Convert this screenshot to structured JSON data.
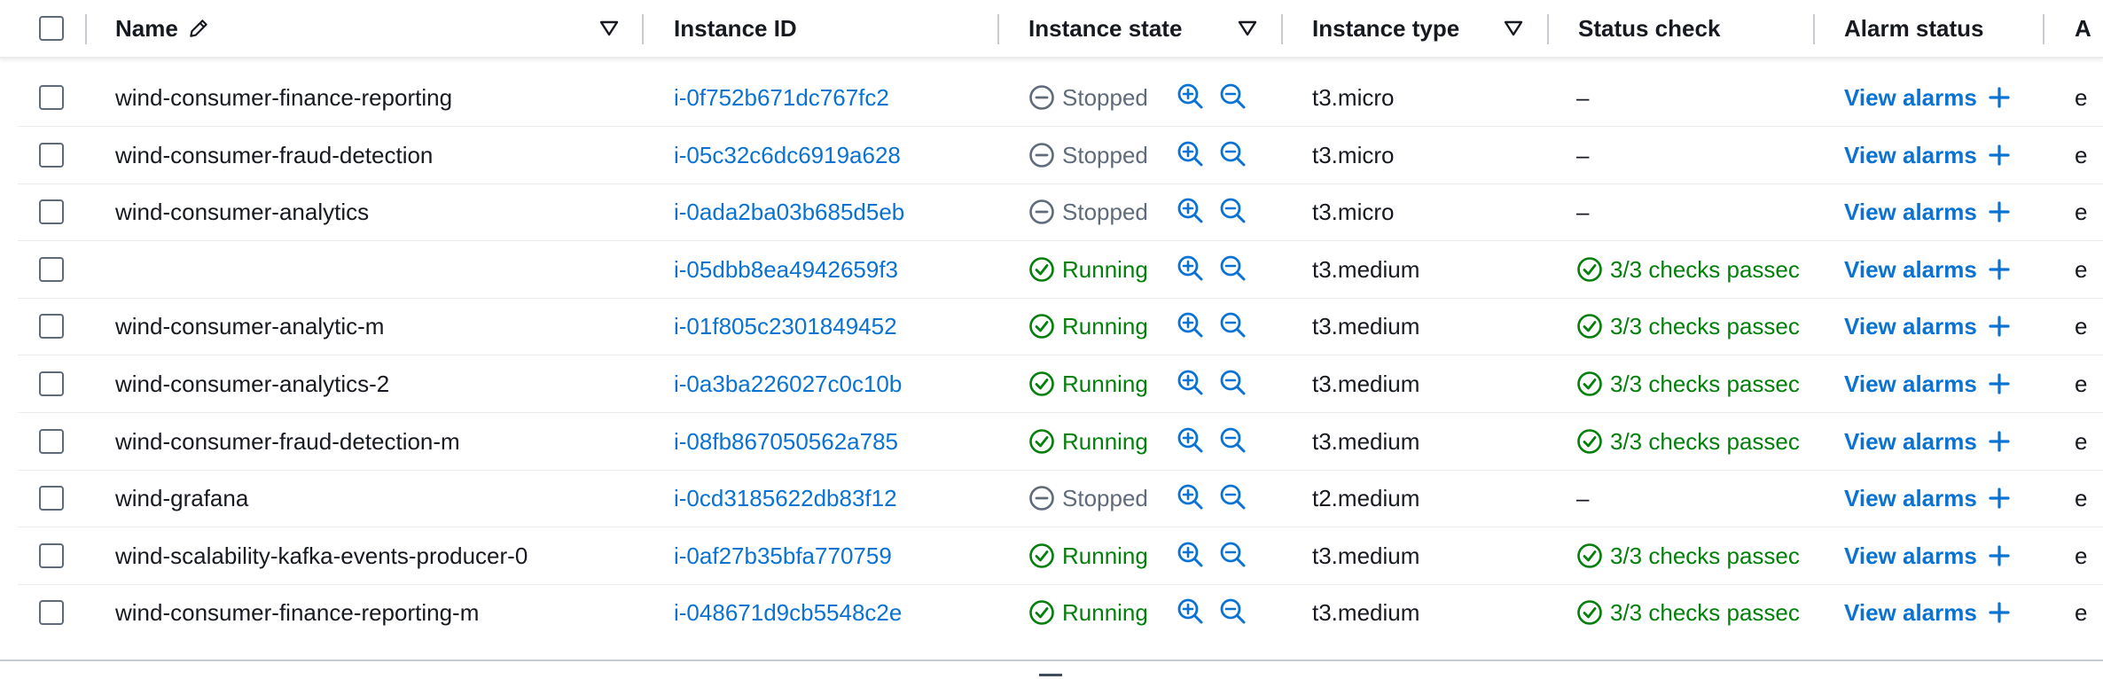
{
  "header": {
    "name": "Name",
    "instance_id": "Instance ID",
    "instance_state": "Instance state",
    "instance_type": "Instance type",
    "status_check": "Status check",
    "alarm_status": "Alarm status",
    "next_col": "A"
  },
  "rows": [
    {
      "name": "wind-consumer-finance-reporting",
      "id": "i-0f752b671dc767fc2",
      "state": "Stopped",
      "type": "t3.micro",
      "status": "–",
      "alarm": "View alarms",
      "next": "e"
    },
    {
      "name": "wind-consumer-fraud-detection",
      "id": "i-05c32c6dc6919a628",
      "state": "Stopped",
      "type": "t3.micro",
      "status": "–",
      "alarm": "View alarms",
      "next": "e"
    },
    {
      "name": "wind-consumer-analytics",
      "id": "i-0ada2ba03b685d5eb",
      "state": "Stopped",
      "type": "t3.micro",
      "status": "–",
      "alarm": "View alarms",
      "next": "e"
    },
    {
      "name": "",
      "id": "i-05dbb8ea4942659f3",
      "state": "Running",
      "type": "t3.medium",
      "status": "3/3 checks passec",
      "alarm": "View alarms",
      "next": "e"
    },
    {
      "name": "wind-consumer-analytic-m",
      "id": "i-01f805c2301849452",
      "state": "Running",
      "type": "t3.medium",
      "status": "3/3 checks passec",
      "alarm": "View alarms",
      "next": "e"
    },
    {
      "name": "wind-consumer-analytics-2",
      "id": "i-0a3ba226027c0c10b",
      "state": "Running",
      "type": "t3.medium",
      "status": "3/3 checks passec",
      "alarm": "View alarms",
      "next": "e"
    },
    {
      "name": "wind-consumer-fraud-detection-m",
      "id": "i-08fb867050562a785",
      "state": "Running",
      "type": "t3.medium",
      "status": "3/3 checks passec",
      "alarm": "View alarms",
      "next": "e"
    },
    {
      "name": "wind-grafana",
      "id": "i-0cd3185622db83f12",
      "state": "Stopped",
      "type": "t2.medium",
      "status": "–",
      "alarm": "View alarms",
      "next": "e"
    },
    {
      "name": "wind-scalability-kafka-events-producer-0",
      "id": "i-0af27b35bfa770759",
      "state": "Running",
      "type": "t3.medium",
      "status": "3/3 checks passec",
      "alarm": "View alarms",
      "next": "e"
    },
    {
      "name": "wind-consumer-finance-reporting-m",
      "id": "i-048671d9cb5548c2e",
      "state": "Running",
      "type": "t3.medium",
      "status": "3/3 checks passec",
      "alarm": "View alarms",
      "next": "e"
    }
  ],
  "colors": {
    "link": "#0972d3",
    "running": "#037f0c",
    "stopped": "#5f6b7a"
  }
}
